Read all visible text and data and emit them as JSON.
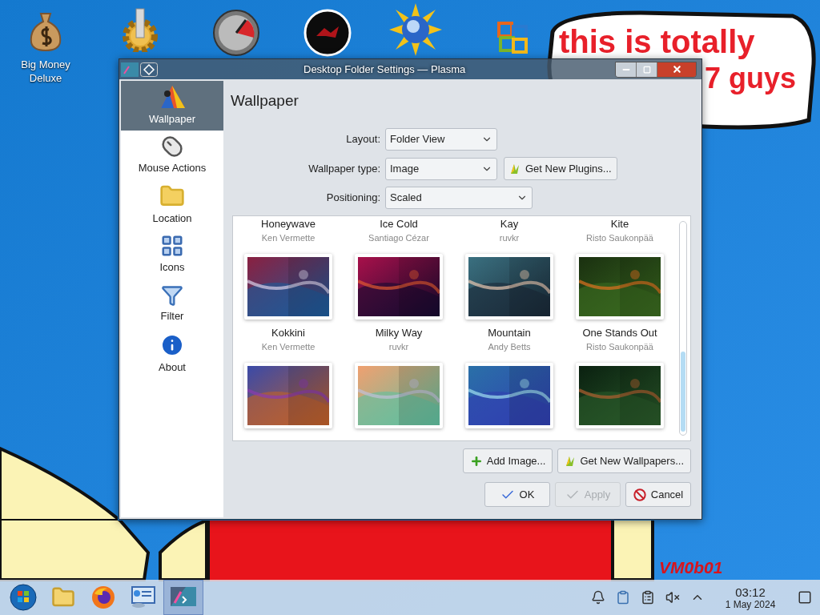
{
  "desktop": {
    "icons": [
      {
        "kind": "money",
        "label": "Big Money Deluxe"
      },
      {
        "kind": "gear"
      },
      {
        "kind": "gauge"
      },
      {
        "kind": "dark-disc"
      },
      {
        "kind": "sun-globe"
      },
      {
        "kind": "office"
      }
    ],
    "wallpaper_texts": [
      {
        "kind": "bubble-line",
        "text": "this is totally"
      },
      {
        "kind": "bubble-line-2",
        "text": "7 guys"
      },
      {
        "kind": "signature",
        "text": "VM0b01"
      }
    ]
  },
  "window": {
    "title": "Desktop Folder Settings — Plasma",
    "sidebar": {
      "items": [
        {
          "kind": "wallpaper",
          "label": "Wallpaper",
          "selected": true
        },
        {
          "kind": "mouse",
          "label": "Mouse Actions",
          "selected": false
        },
        {
          "kind": "folder",
          "label": "Location",
          "selected": false
        },
        {
          "kind": "icons",
          "label": "Icons",
          "selected": false
        },
        {
          "kind": "filter",
          "label": "Filter",
          "selected": false
        },
        {
          "kind": "about",
          "label": "About",
          "selected": false
        }
      ]
    },
    "heading": "Wallpaper",
    "form": [
      {
        "label": "Layout:",
        "value": "Folder View",
        "kind": "short"
      },
      {
        "label": "Wallpaper type:",
        "value": "Image",
        "kind": "with-button",
        "button": "Get New Plugins..."
      },
      {
        "label": "Positioning:",
        "value": "Scaled",
        "kind": "wide"
      }
    ],
    "wallpapers": [
      [
        {
          "name": "Honeywave",
          "author": "Ken Vermette"
        },
        {
          "name": "Ice Cold",
          "author": "Santiago Cézar"
        },
        {
          "name": "Kay",
          "author": "ruvkr"
        },
        {
          "name": "Kite",
          "author": "Risto Saukonpää"
        }
      ],
      [
        {
          "kind": "picture",
          "name": "Kokkini",
          "author": "Ken Vermette"
        },
        {
          "kind": "picture",
          "name": "Milky Way",
          "author": "ruvkr"
        },
        {
          "kind": "picture",
          "name": "Mountain",
          "author": "Andy Betts"
        },
        {
          "kind": "picture",
          "name": "One Stands Out",
          "author": "Risto Saukonpää"
        }
      ],
      [
        {
          "kind": "picture"
        },
        {
          "kind": "picture"
        },
        {
          "kind": "picture"
        },
        {
          "kind": "picture"
        }
      ]
    ],
    "grid_buttons": [
      {
        "kind": "add",
        "label": "Add Image..."
      },
      {
        "kind": "get",
        "label": "Get New Wallpapers..."
      }
    ],
    "dialog_buttons": [
      {
        "kind": "ok",
        "label": "OK",
        "disabled": false
      },
      {
        "kind": "apply",
        "label": "Apply",
        "disabled": true
      },
      {
        "kind": "cancel",
        "label": "Cancel",
        "disabled": false
      }
    ]
  },
  "taskbar": {
    "items": [
      {
        "kind": "start",
        "selected": false
      },
      {
        "kind": "files",
        "selected": false
      },
      {
        "kind": "browser",
        "selected": false
      },
      {
        "kind": "monitor",
        "selected": false
      },
      {
        "kind": "settings",
        "selected": true
      }
    ],
    "tray": [
      {
        "kind": "bell"
      },
      {
        "kind": "clipboard"
      },
      {
        "kind": "notes"
      },
      {
        "kind": "muted"
      },
      {
        "kind": "expand"
      }
    ],
    "clock": {
      "time": "03:12",
      "date": "1 May 2024"
    }
  }
}
